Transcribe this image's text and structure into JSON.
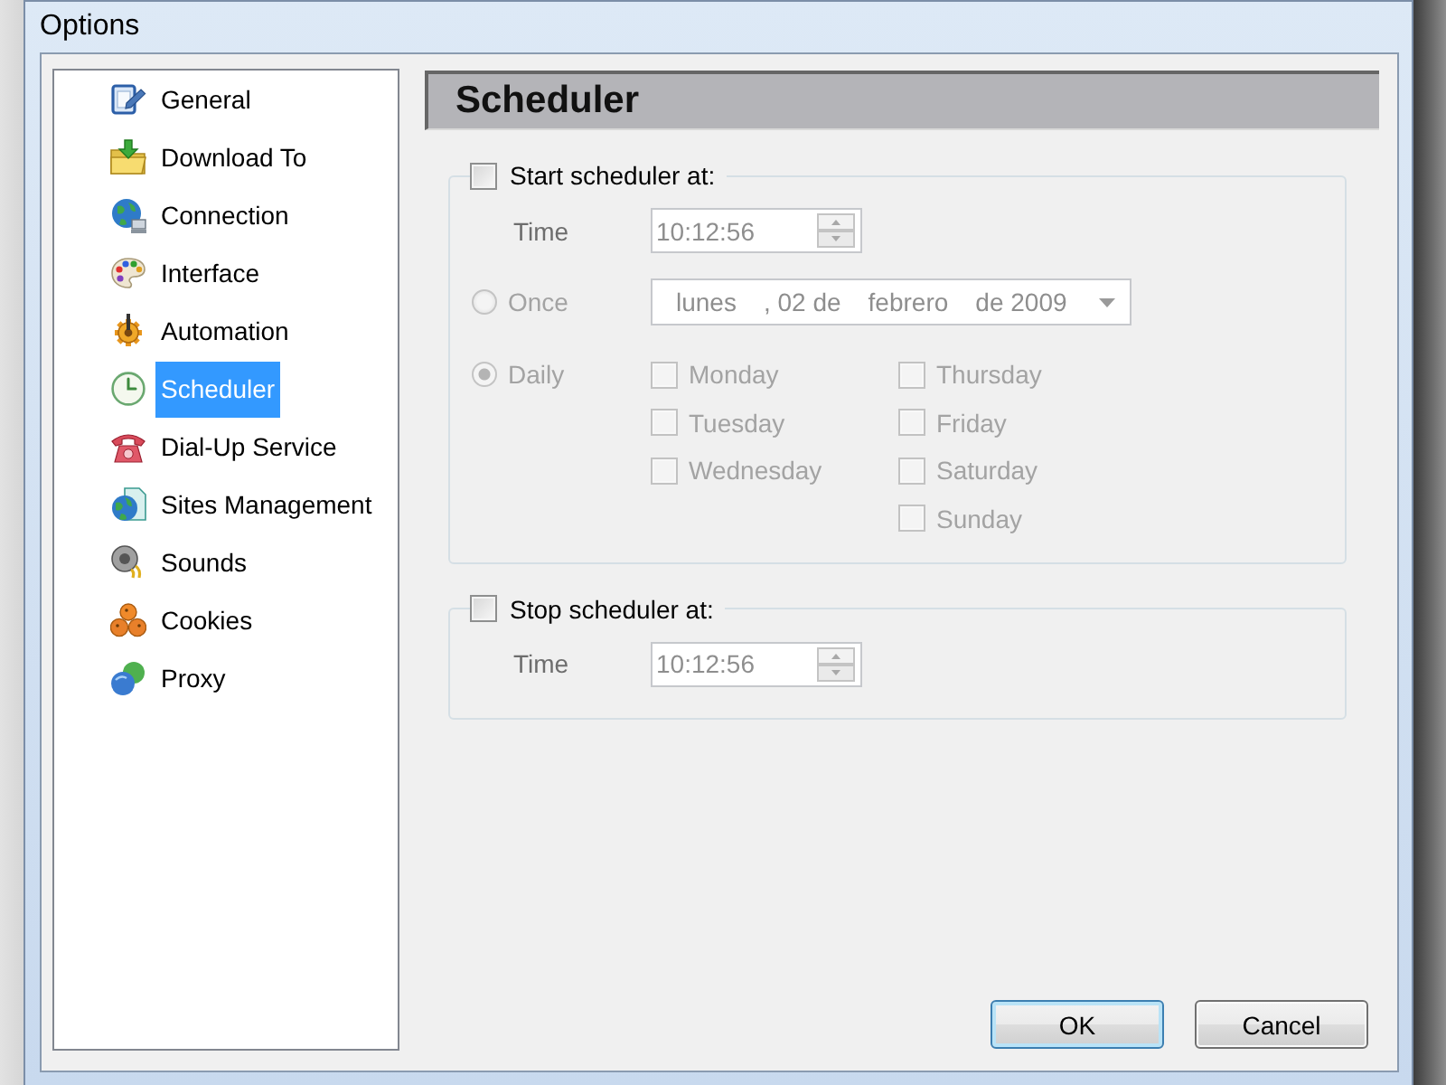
{
  "window": {
    "title": "Options"
  },
  "sidebar": {
    "items": [
      {
        "label": "General",
        "selected": false
      },
      {
        "label": "Download To",
        "selected": false
      },
      {
        "label": "Connection",
        "selected": false
      },
      {
        "label": "Interface",
        "selected": false
      },
      {
        "label": "Automation",
        "selected": false
      },
      {
        "label": "Scheduler",
        "selected": true
      },
      {
        "label": "Dial-Up Service",
        "selected": false
      },
      {
        "label": "Sites Management",
        "selected": false
      },
      {
        "label": "Sounds",
        "selected": false
      },
      {
        "label": "Cookies",
        "selected": false
      },
      {
        "label": "Proxy",
        "selected": false
      }
    ]
  },
  "panel": {
    "title": "Scheduler",
    "start": {
      "label": "Start scheduler at:",
      "checked": false,
      "time_label": "Time",
      "time": "10:12:56",
      "modes": [
        {
          "kind": "date",
          "label": "Once",
          "selected": false,
          "date_parts": [
            "lunes",
            ", 02 de",
            "febrero",
            "de 2009"
          ]
        },
        {
          "kind": "weekdays",
          "label": "Daily",
          "selected": true,
          "day_columns": [
            [
              {
                "label": "Monday",
                "checked": false
              },
              {
                "label": "Tuesday",
                "checked": false
              },
              {
                "label": "Wednesday",
                "checked": false
              }
            ],
            [
              {
                "label": "Thursday",
                "checked": false
              },
              {
                "label": "Friday",
                "checked": false
              },
              {
                "label": "Saturday",
                "checked": false
              },
              {
                "label": "Sunday",
                "checked": false
              }
            ]
          ]
        }
      ]
    },
    "stop": {
      "label": "Stop scheduler at:",
      "checked": false,
      "time_label": "Time",
      "time": "10:12:56"
    }
  },
  "buttons": [
    {
      "label": "OK",
      "focused": true
    },
    {
      "label": "Cancel",
      "focused": false
    }
  ]
}
